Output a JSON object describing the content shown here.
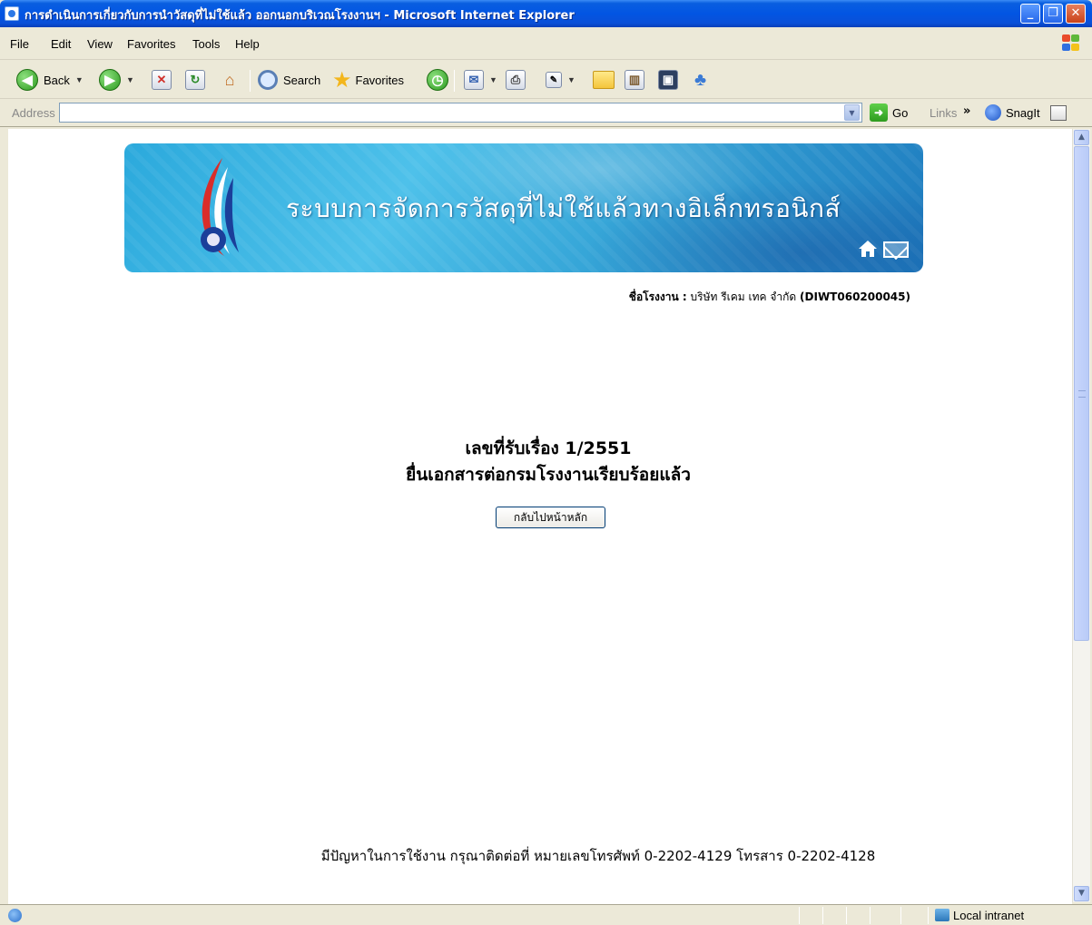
{
  "window": {
    "title": "การดำเนินการเกี่ยวกับการนำวัสดุที่ไม่ใช้แล้ว ออกนอกบริเวณโรงงานฯ - Microsoft Internet Explorer",
    "controls": {
      "minimize": "_",
      "maximize": "❐",
      "close": "✕"
    }
  },
  "menu": [
    "File",
    "Edit",
    "View",
    "Favorites",
    "Tools",
    "Help"
  ],
  "toolbar": {
    "back_label": "Back",
    "search_label": "Search",
    "favorites_label": "Favorites"
  },
  "address": {
    "label": "Address",
    "value": "",
    "go_label": "Go",
    "links_label": "Links",
    "snagit_label": "SnagIt"
  },
  "banner": {
    "title": "ระบบการจัดการวัสดุที่ไม่ใช้แล้วทางอิเล็กทรอนิกส์"
  },
  "factory": {
    "label": "ชื่อโรงงาน :",
    "name": "บริษัท รีเคม เทค จำกัด",
    "code": "(DIWT060200045)"
  },
  "message": {
    "line1": "เลขที่รับเรื่อง 1/2551",
    "line2": "ยื่นเอกสารต่อกรมโรงงานเรียบร้อยแล้ว"
  },
  "buttons": {
    "back_home": "กลับไปหน้าหลัก"
  },
  "footer": {
    "text": "มีปัญหาในการใช้งาน กรุณาติดต่อที่ หมายเลขโทรศัพท์ 0-2202-4129 โทรสาร 0-2202-4128"
  },
  "status": {
    "zone": "Local intranet"
  },
  "colors": {
    "titlebar": "#0255e3",
    "chrome": "#ece9d8",
    "banner": "#36a6d8"
  }
}
